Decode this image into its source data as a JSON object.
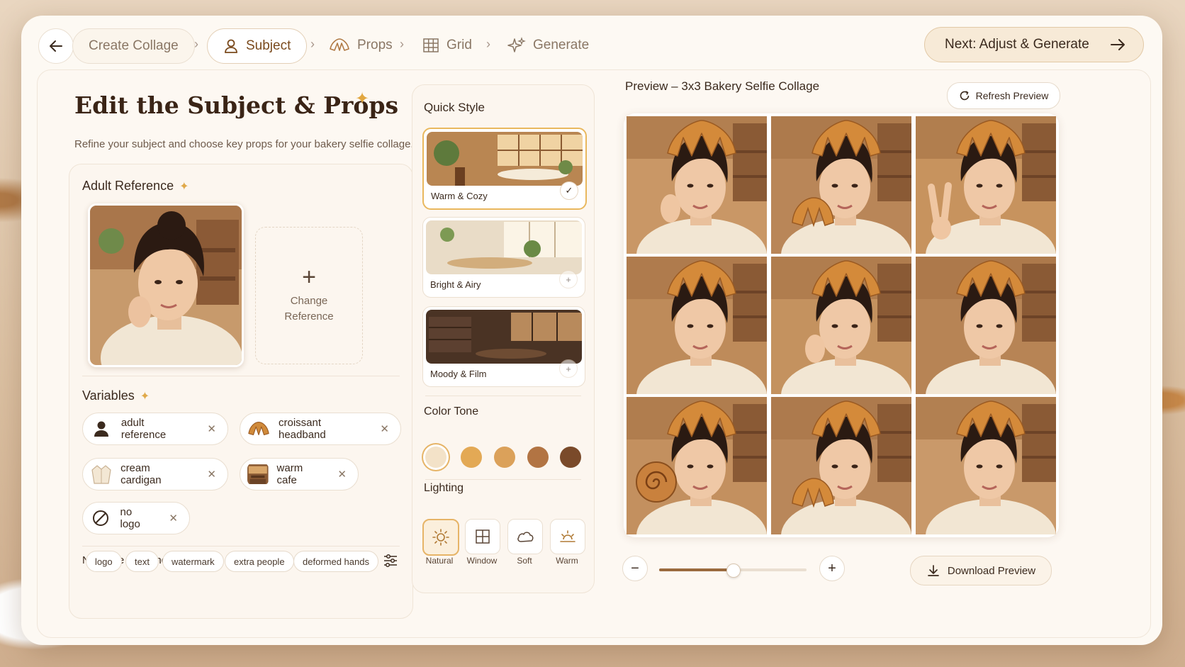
{
  "nav": {
    "steps": [
      {
        "label": "Create Collage",
        "icon": "none"
      },
      {
        "label": "Subject",
        "icon": "person-icon"
      },
      {
        "label": "Props",
        "icon": "croissant-icon"
      },
      {
        "label": "Grid",
        "icon": "grid-icon"
      },
      {
        "label": "Generate",
        "icon": "sparkle-icon"
      }
    ],
    "active_step": "Subject",
    "next_label": "Next: Adjust & Generate"
  },
  "editor": {
    "title": "Edit the Subject & Props",
    "subtitle": "Refine your subject and choose key props for your bakery selfie collage.",
    "adult_reference": {
      "label": "Adult Reference",
      "change_label_line1": "Change",
      "change_label_line2": "Reference"
    },
    "variables": {
      "label": "Variables",
      "chips": [
        {
          "label": "adult reference",
          "icon": "person-icon"
        },
        {
          "label": "croissant headband",
          "icon": "croissant-icon"
        },
        {
          "label": "cream cardigan",
          "icon": "cardigan-icon"
        },
        {
          "label": "warm cafe",
          "icon": "cafe-thumbnail-icon"
        },
        {
          "label": "no logo",
          "icon": "no-symbol-icon"
        }
      ]
    },
    "negative_guidance": {
      "label": "Negative Guidance",
      "tags": [
        "logo",
        "text",
        "watermark",
        "extra people",
        "deformed hands"
      ]
    }
  },
  "style": {
    "quick_style_label": "Quick Style",
    "presets": [
      {
        "label": "Warm & Cozy",
        "selected": true
      },
      {
        "label": "Bright & Airy",
        "selected": false
      },
      {
        "label": "Moody & Film",
        "selected": false
      }
    ],
    "color_tone_label": "Color Tone",
    "color_tones": [
      "#f3e2c8",
      "#e3a955",
      "#dba15a",
      "#b27443",
      "#7a4a2a"
    ],
    "selected_tone_index": 0,
    "lighting_label": "Lighting",
    "lighting_options": [
      {
        "label": "Natural",
        "icon": "sun-icon",
        "selected": true
      },
      {
        "label": "Window",
        "icon": "window-icon",
        "selected": false
      },
      {
        "label": "Soft",
        "icon": "cloud-icon",
        "selected": false
      },
      {
        "label": "Warm",
        "icon": "sunset-icon",
        "selected": false
      }
    ]
  },
  "preview": {
    "title": "Preview – 3x3 Bakery Selfie Collage",
    "refresh_label": "Refresh Preview",
    "download_label": "Download Preview",
    "zoom_level": 0.5,
    "tiles": [
      {
        "pose": "hand-on-cheek"
      },
      {
        "pose": "holding-croissant"
      },
      {
        "pose": "peace-sign"
      },
      {
        "pose": "eyes-closed-smile"
      },
      {
        "pose": "hand-on-cheek"
      },
      {
        "pose": "tilted-head-smile"
      },
      {
        "pose": "holding-cinnamon-roll"
      },
      {
        "pose": "kiss-face-with-croissant"
      },
      {
        "pose": "soft-smile"
      }
    ]
  },
  "colors": {
    "accent": "#e6b467",
    "brand_brown": "#7a4a1d",
    "panel": "#fdf8f2"
  }
}
